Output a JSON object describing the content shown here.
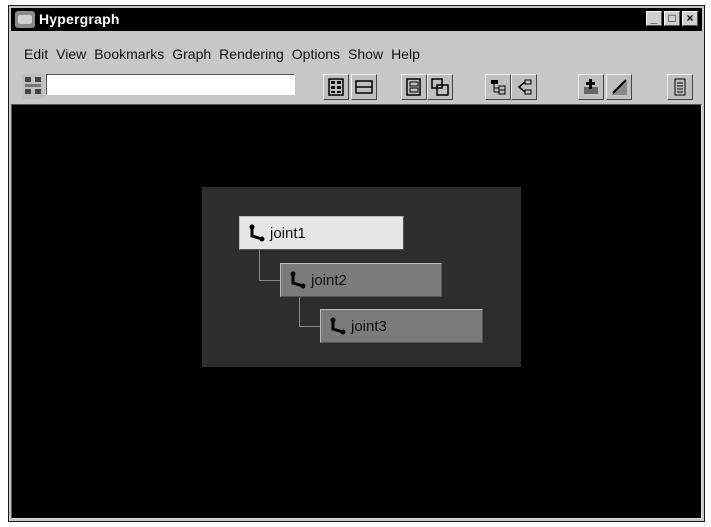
{
  "window": {
    "title": "Hypergraph",
    "controls": [
      "minimize-icon",
      "maximize-icon",
      "close-icon"
    ]
  },
  "menubar": {
    "items": [
      "Edit",
      "View",
      "Bookmarks",
      "Graph",
      "Rendering",
      "Options",
      "Show",
      "Help"
    ]
  },
  "toolbar": {
    "search_value": "",
    "buttons": [
      "scene-hierarchy-icon",
      "input-output-connections-icon",
      "graph-up-downstream-icon",
      "graph-layout-icon",
      "expand-hierarchy-icon",
      "collapse-hierarchy-icon",
      "add-bookmark-icon",
      "clear-view-icon",
      "options-menu-icon"
    ]
  },
  "graph": {
    "nodes": [
      {
        "label": "joint1",
        "state": "selected",
        "icon": "joint-icon"
      },
      {
        "label": "joint2",
        "state": "normal",
        "icon": "joint-icon"
      },
      {
        "label": "joint3",
        "state": "normal",
        "icon": "joint-icon"
      }
    ]
  },
  "colors": {
    "canvas_bg": "#000000",
    "group_bg": "#2d2d2d",
    "node_selected": "#e6e6e6",
    "node_normal": "#7b7b7b",
    "chrome": "#c7c7c7"
  }
}
